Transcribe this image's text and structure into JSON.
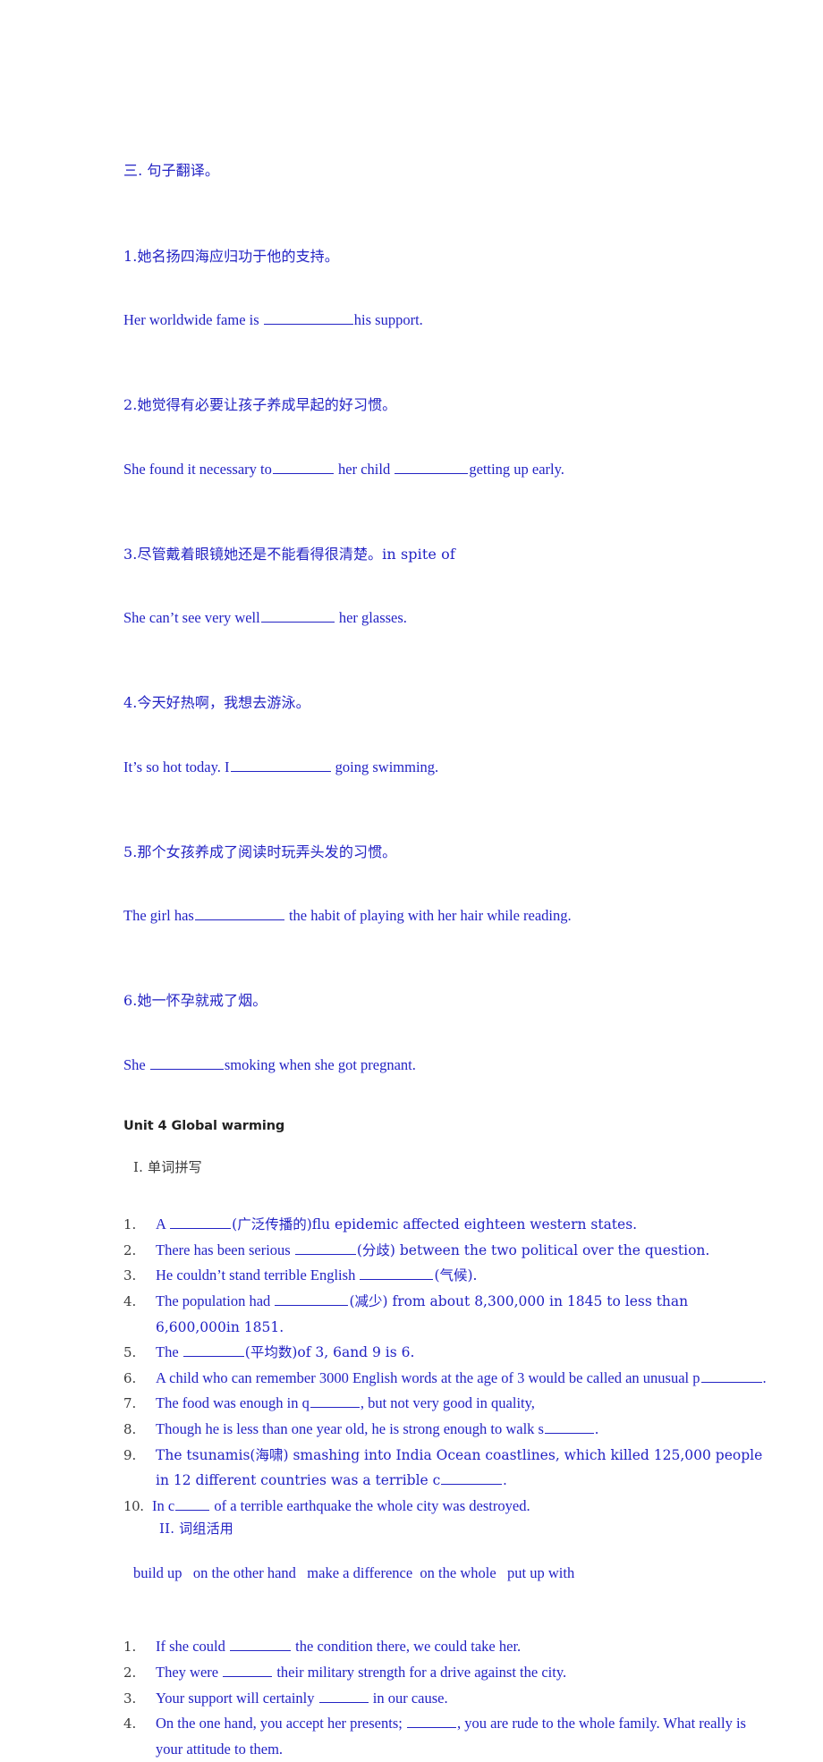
{
  "document": {
    "text_color": "#2323c4",
    "heading_color": "#3a3a3a",
    "unit_title_color": "#222222"
  },
  "translation_section": {
    "heading": "三. 句子翻译。",
    "items": [
      {
        "cn": "1.她名扬四海应归功于他的支持。",
        "en_before": "Her worldwide fame is ",
        "en_mid": "",
        "en_after": "his support."
      },
      {
        "cn": "2.她觉得有必要让孩子养成早起的好习惯。",
        "en_before": "She found it necessary to",
        "en_mid": " her child ",
        "en_after": "getting up early."
      },
      {
        "cn": "3.尽管戴着眼镜她还是不能看得很清楚。in spite of",
        "en_before": "She can’t see very well",
        "en_mid": "",
        "en_after": " her glasses."
      },
      {
        "cn": "4.今天好热啊，我想去游泳。",
        "en_before": "It’s so hot today. I",
        "en_mid": "",
        "en_after": " going swimming."
      },
      {
        "cn": "5.那个女孩养成了阅读时玩弄头发的习惯。",
        "en_before": "The girl has",
        "en_mid": "",
        "en_after": " the habit of playing with her hair while reading."
      },
      {
        "cn": "6.她一怀孕就戒了烟。",
        "en_before": "She ",
        "en_mid": "",
        "en_after": "smoking when she got pregnant."
      }
    ]
  },
  "unit_title": "Unit 4 Global warming",
  "section_one": {
    "heading": "I. 单词拼写",
    "items": [
      {
        "num": "1.",
        "parts": [
          "A ",
          "(广泛传播的)flu epidemic affected eighteen western states."
        ]
      },
      {
        "num": "2.",
        "parts": [
          "There has been serious ",
          "(分歧) between the two political over the question."
        ]
      },
      {
        "num": "3.",
        "parts": [
          "He couldn’t stand terrible English ",
          "(气候)."
        ]
      },
      {
        "num": "4.",
        "parts": [
          "The population had ",
          "(减少) from about 8,300,000 in 1845 to less than 6,600,000in 1851."
        ]
      },
      {
        "num": "5.",
        "parts": [
          "The ",
          "(平均数)of 3, 6and 9 is 6."
        ]
      },
      {
        "num": "6.",
        "parts": [
          "A child who can remember 3000 English words at the age of 3 would be called an unusual p",
          "."
        ]
      },
      {
        "num": "7.",
        "parts": [
          "The food was enough in q",
          ", but not very good in quality,"
        ]
      },
      {
        "num": "8.",
        "parts": [
          "Though he is less than one year old, he is strong enough to walk s",
          "."
        ]
      },
      {
        "num": "9.",
        "parts": [
          "The tsunamis(海啸) smashing into India Ocean coastlines, which killed 125,000 people in 12 different countries was a terrible c",
          "."
        ]
      },
      {
        "num": "10.",
        "parts": [
          "In c",
          " of a terrible earthquake the whole city was destroyed."
        ]
      }
    ]
  },
  "section_two": {
    "heading": "II. 词组活用",
    "phrase_bank": "build up   on the other hand   make a difference  on the whole   put up with",
    "items": [
      {
        "num": "1.",
        "before": "If she could ",
        "after": " the condition there, we could take her."
      },
      {
        "num": "2.",
        "before": "They were ",
        "after": " their military strength for a drive against the city."
      },
      {
        "num": "3.",
        "before": "Your support will certainly ",
        "after": " in our cause."
      },
      {
        "num": "4.",
        "before": "On the one hand, you accept her presents; ",
        "after": ", you are rude to the whole family. What really is your attitude to them."
      }
    ]
  }
}
